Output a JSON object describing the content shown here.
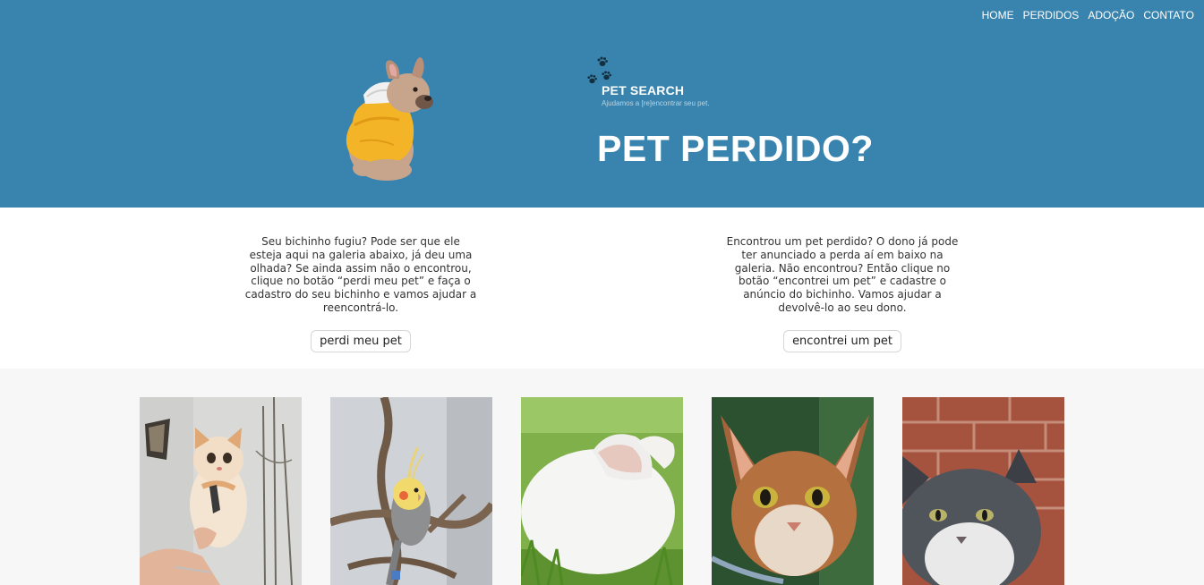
{
  "nav": {
    "items": [
      "HOME",
      "PERDIDOS",
      "ADOÇÃO",
      "CONTATO"
    ]
  },
  "brand": {
    "title": "PET SEARCH",
    "tagline": "Ajudamos a [re]encontrar seu pet."
  },
  "hero": {
    "title": "PET PERDIDO?"
  },
  "lost": {
    "text": "Seu bichinho fugiu? Pode ser que ele esteja aqui na galeria abaixo, já deu uma olhada? Se ainda assim não o encontrou, clique no botão “perdi meu pet” e faça o cadastro do seu bichinho e vamos ajudar a reencontrá-lo.",
    "button": "perdi meu pet"
  },
  "found": {
    "text": "Encontrou um pet perdido? O dono já pode ter anunciado a perda aí em baixo na galeria. Não encontrou? Então clique no botão “encontrei um pet” e cadastre o anúncio do bichinho. Vamos ajudar a devolvê-lo ao seu dono.",
    "button": "encontrei um pet"
  },
  "gallery": {
    "items": [
      "kitten",
      "cockatiel",
      "rabbit",
      "abyssinian-cat",
      "gray-cat"
    ]
  },
  "colors": {
    "header": "#3884ae",
    "gallery_bg": "#f7f7f7"
  }
}
